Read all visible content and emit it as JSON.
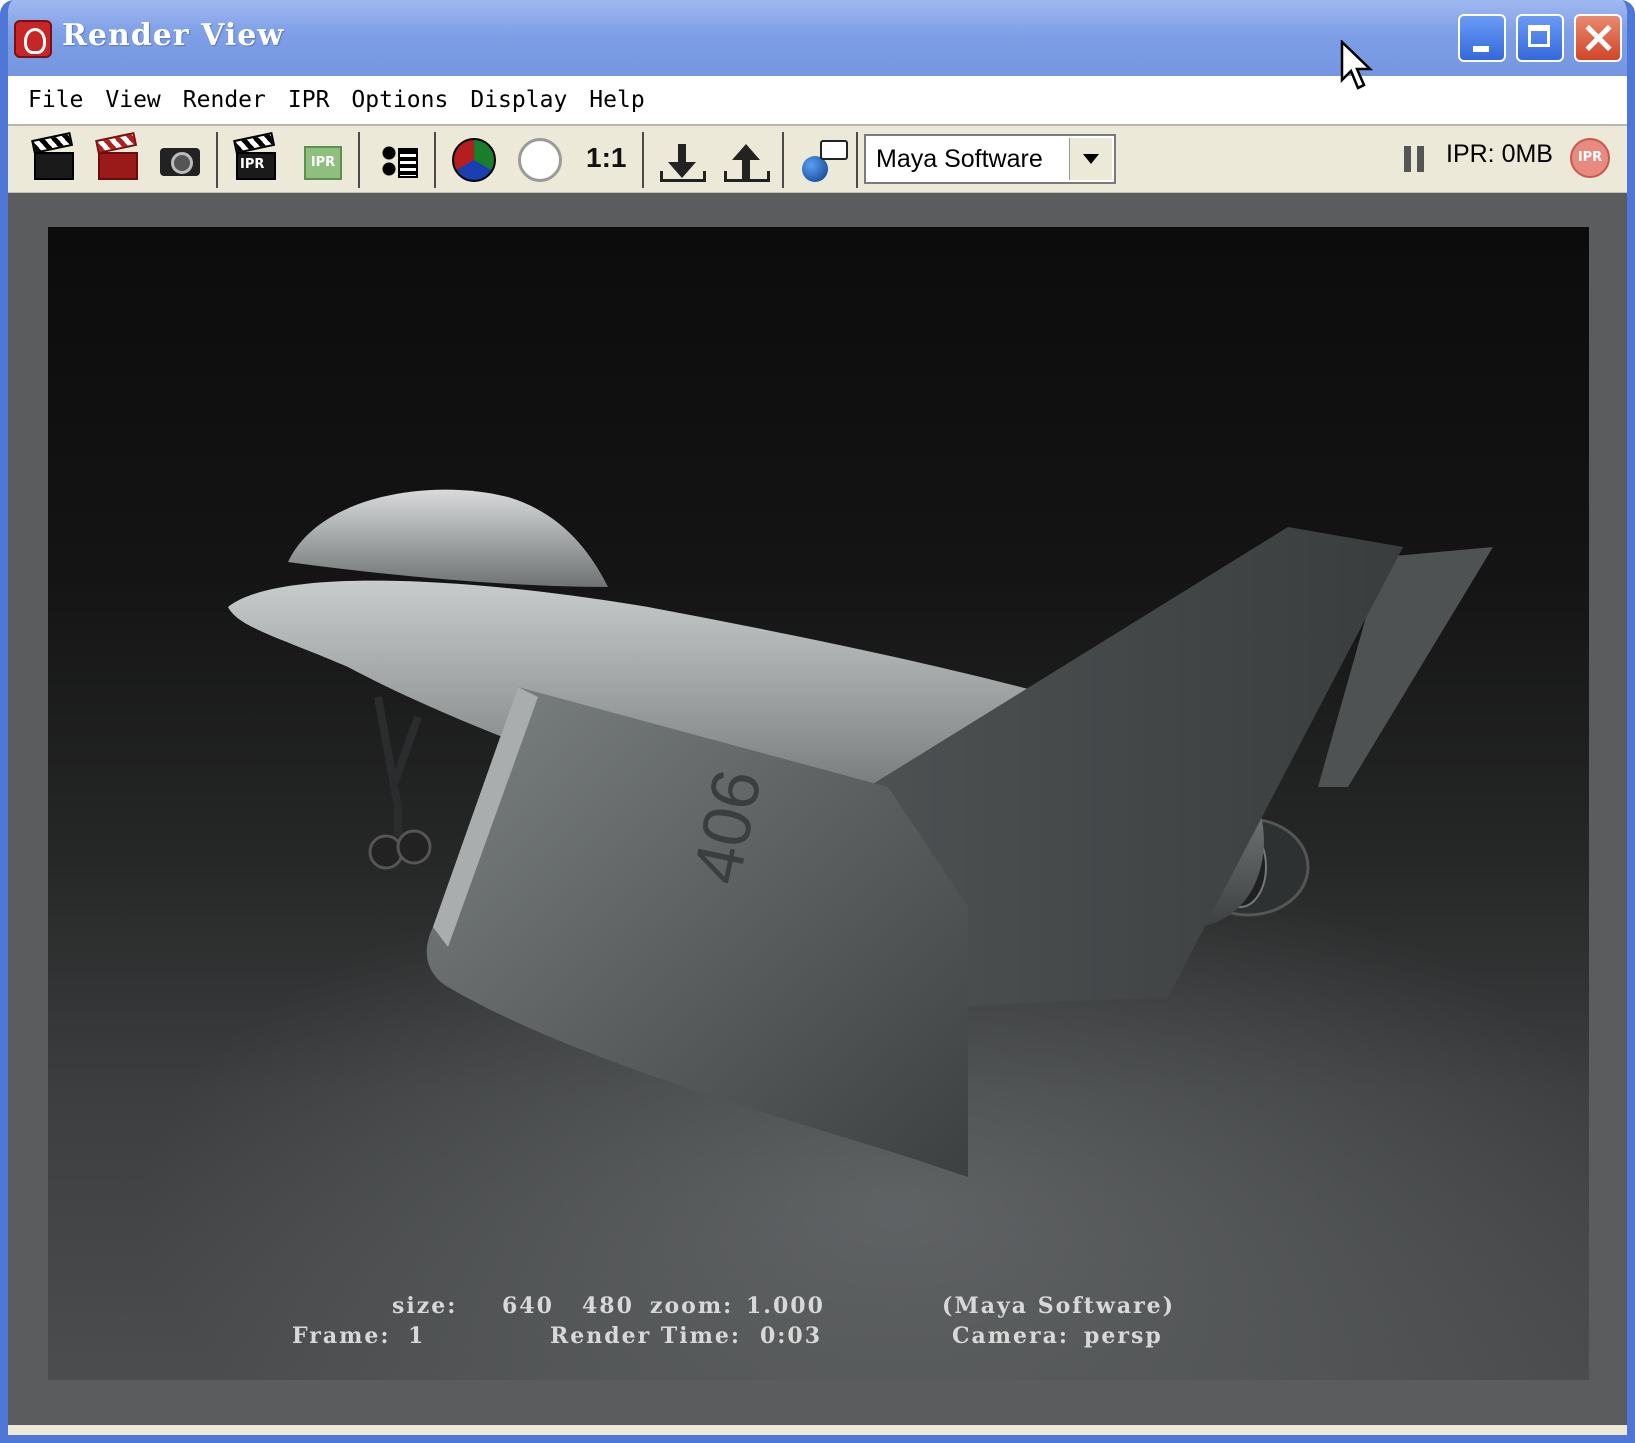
{
  "window": {
    "title": "Render View",
    "controls": [
      "minimize",
      "maximize",
      "close"
    ]
  },
  "menubar": {
    "items": [
      "File",
      "View",
      "Render",
      "IPR",
      "Options",
      "Display",
      "Help"
    ]
  },
  "toolbar": {
    "icons": [
      "redo-render-icon",
      "render-region-icon",
      "snapshot-icon",
      "ipr-render-icon",
      "refresh-ipr-icon",
      "render-sequence-icon",
      "display-rgb-icon",
      "display-alpha-icon",
      "real-size-icon",
      "keep-image-icon",
      "remove-image-icon",
      "render-diagnostics-icon"
    ],
    "ratio_label": "1:1",
    "ipr_label": "IPR",
    "renderer": "Maya Software",
    "ipr_memory": "IPR: 0MB",
    "ipr_badge": "IPR"
  },
  "render": {
    "size_label": "size:",
    "size_w": "640",
    "size_h": "480",
    "zoom_label": "zoom:",
    "zoom_value": "1.000",
    "renderer_info": "(Maya Software)",
    "frame_label": "Frame:",
    "frame_value": "1",
    "render_time_label": "Render Time:",
    "render_time_value": "0:03",
    "camera_label": "Camera:",
    "camera_value": "persp",
    "aircraft_number": "406"
  }
}
